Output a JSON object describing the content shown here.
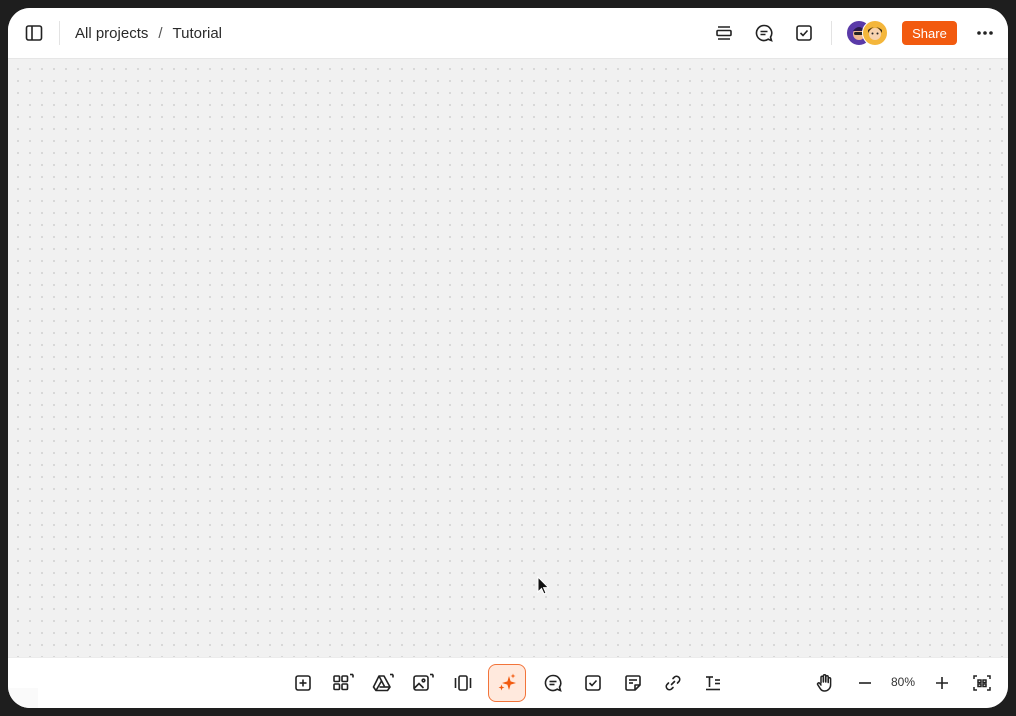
{
  "topbar": {
    "breadcrumb": {
      "parent": "All projects",
      "separator": "/",
      "current": "Tutorial"
    },
    "share_label": "Share"
  },
  "bottombar": {
    "zoom_level": "80%"
  },
  "colors": {
    "accent": "#f25a0f",
    "magic_bg": "#ffe9dd",
    "canvas_bg": "#f1f1f1"
  },
  "icons": {
    "topbar": [
      "sidebar-toggle-icon",
      "presentation-icon",
      "comment-icon",
      "checkbox-icon",
      "more-icon"
    ],
    "toolbar": [
      "add-box-icon",
      "apps-grid-icon",
      "drive-icon",
      "image-icon",
      "carousel-icon",
      "ai-sparkle-icon",
      "comment-icon",
      "checkbox-icon",
      "note-icon",
      "link-icon",
      "text-icon"
    ],
    "view": [
      "hand-icon",
      "zoom-out-icon",
      "zoom-in-icon",
      "fit-screen-icon"
    ]
  }
}
